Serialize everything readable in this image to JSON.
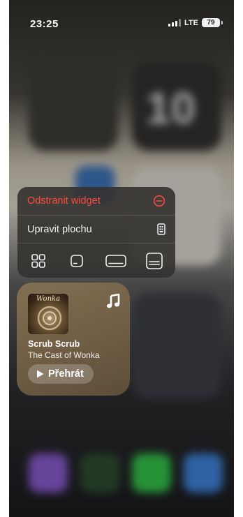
{
  "status_bar": {
    "time": "23:25",
    "network": "LTE",
    "battery": "79"
  },
  "background": {
    "calendar_day": "10"
  },
  "context_menu": {
    "remove_label": "Odstranit widget",
    "edit_label": "Upravit plochu",
    "accent_color": "#ff4a3d",
    "size_options": [
      "small-grid",
      "small",
      "medium",
      "large"
    ]
  },
  "music_widget": {
    "album_title": "Wonka",
    "song": "Scrub Scrub",
    "artist": "The Cast of Wonka",
    "play_label": "Přehrát"
  }
}
